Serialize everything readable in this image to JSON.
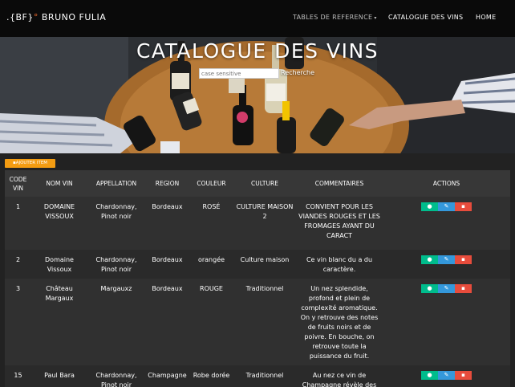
{
  "navbar": {
    "brand_prefix": ".{BF}",
    "brand_dot": "°",
    "brand_name": "BRUNO FULIA",
    "tables_label": "TABLES DE REFERENCE",
    "catalogue_label": "CATALOGUE DES VINS",
    "home_label": "HOME"
  },
  "hero": {
    "title": "CATALOGUE DES VINS",
    "search_placeholder": "case sensitive",
    "search_button": "Recherche"
  },
  "add_button": "AJOUTER ITEM",
  "table": {
    "headers": [
      "CODE VIN",
      "NOM VIN",
      "APPELLATION",
      "REGION",
      "COULEUR",
      "CULTURE",
      "COMMENTAIRES",
      "ACTIONS"
    ],
    "rows": [
      {
        "code": "1",
        "nom": "DOMAINE VISSOUX",
        "appellation": "Chardonnay, Pinot noir",
        "region": "Bordeaux",
        "couleur": "ROSÉ",
        "culture": "CULTURE MAISON 2",
        "commentaires": "CONVIENT POUR LES VIANDES ROUGES ET LES FROMAGES AYANT DU CARACT"
      },
      {
        "code": "2",
        "nom": "Domaine Vissoux",
        "appellation": "Chardonnay, Pinot noir",
        "region": "Bordeaux",
        "couleur": "orangée",
        "culture": "Culture maison",
        "commentaires": "Ce vin blanc du a du caractère."
      },
      {
        "code": "3",
        "nom": "Château Margaux",
        "appellation": "Margauxz",
        "region": "Bordeaux",
        "couleur": "ROUGE",
        "culture": "Traditionnel",
        "commentaires": "Un nez splendide, profond et plein de complexité aromatique. On y retrouve des notes de fruits noirs et de poivre. En bouche, on retrouve toute la puissance du fruit."
      },
      {
        "code": "15",
        "nom": "Paul Bara",
        "appellation": "Chardonnay, Pinot noir",
        "region": "Champagne",
        "couleur": "Robe dorée",
        "culture": "Traditionnel",
        "commentaires": "Au nez ce vin de Champagne révèle des"
      }
    ]
  },
  "icons": {
    "view": "eye-icon",
    "edit": "pencil-icon",
    "delete": "trash-icon"
  },
  "colors": {
    "accent": "#e8682a",
    "add": "#f39c12",
    "view": "#00bc8c",
    "edit": "#3498db",
    "delete": "#e74c3c"
  }
}
